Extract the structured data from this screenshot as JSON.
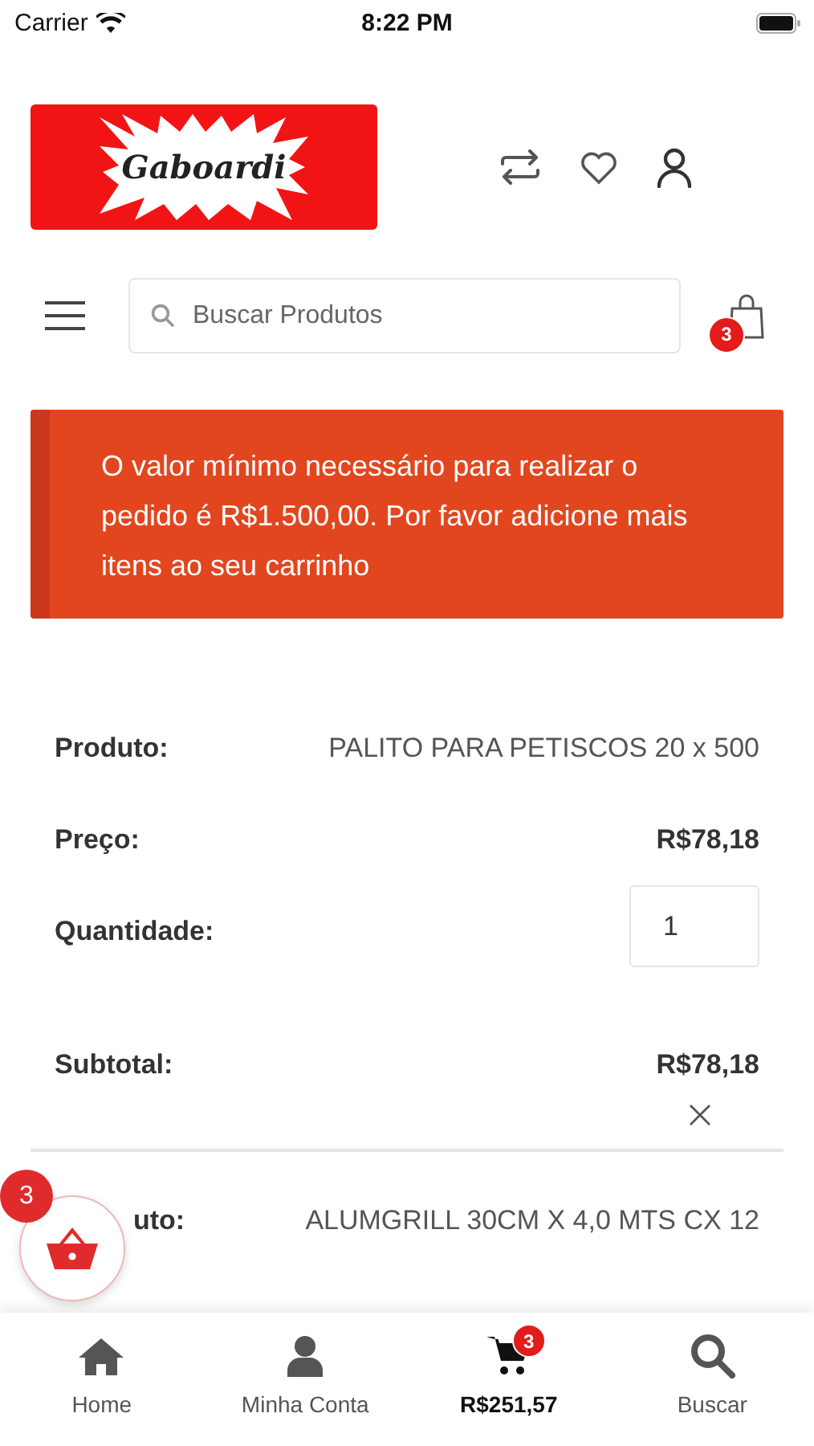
{
  "status_bar": {
    "carrier": "Carrier",
    "time": "8:22 PM"
  },
  "header": {
    "logo_text": "Gaboardi"
  },
  "search": {
    "placeholder": "Buscar Produtos"
  },
  "cart_badge": "3",
  "alert": {
    "message": "O valor mínimo necessário para realizar o pedido é R$1.500,00. Por favor adicione mais itens ao seu carrinho"
  },
  "items": [
    {
      "removable": true,
      "fields": [
        {
          "kind": "text",
          "label": "Produto:",
          "value": "PALITO PARA PETISCOS 20 x 500"
        },
        {
          "kind": "price",
          "label": "Preço:",
          "value": "R$78,18"
        },
        {
          "kind": "quantity",
          "label": "Quantidade:",
          "value": "1"
        },
        {
          "kind": "price",
          "label": "Subtotal:",
          "value": "R$78,18"
        }
      ]
    },
    {
      "removable": false,
      "fields": [
        {
          "kind": "cut",
          "label": "uto:",
          "value": "ALUMGRILL 30CM X 4,0 MTS CX 12"
        }
      ]
    }
  ],
  "floating_cart": {
    "badge": "3"
  },
  "tab_bar": [
    {
      "kind": "home",
      "label": "Home",
      "selected": false
    },
    {
      "kind": "account",
      "label": "Minha Conta",
      "selected": false
    },
    {
      "kind": "cart",
      "label": "R$251,57",
      "badge": "3",
      "selected": true
    },
    {
      "kind": "search",
      "label": "Buscar",
      "selected": false
    }
  ]
}
